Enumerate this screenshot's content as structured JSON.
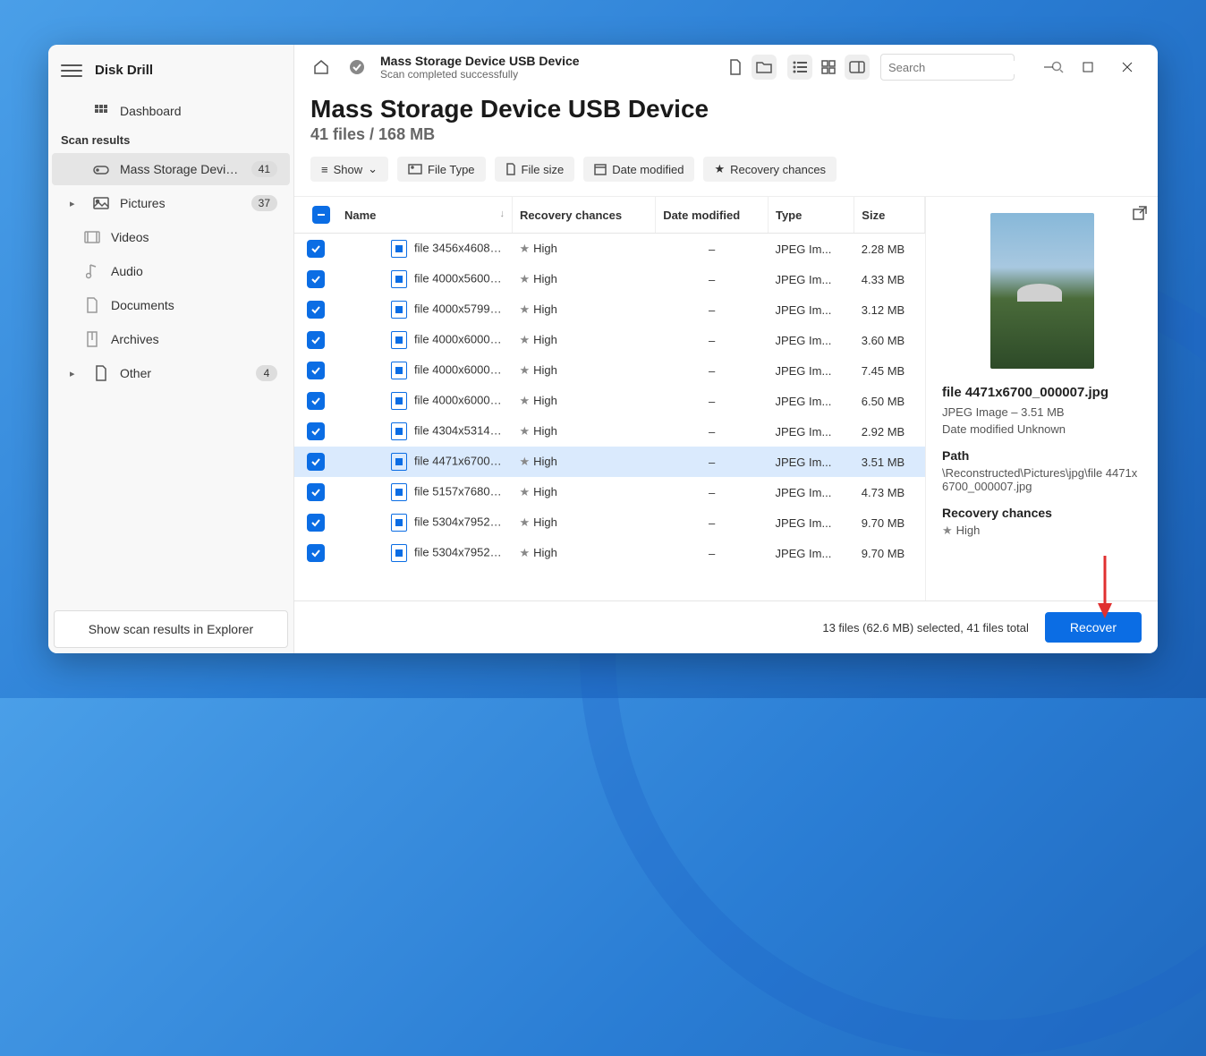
{
  "app": {
    "title": "Disk Drill"
  },
  "sidebar": {
    "dashboard": "Dashboard",
    "scan_results_label": "Scan results",
    "items": [
      {
        "label": "Mass Storage Device USB...",
        "badge": "41",
        "icon": "drive"
      },
      {
        "label": "Pictures",
        "badge": "37",
        "icon": "image",
        "expandable": true
      },
      {
        "label": "Videos",
        "icon": "video"
      },
      {
        "label": "Audio",
        "icon": "audio"
      },
      {
        "label": "Documents",
        "icon": "document"
      },
      {
        "label": "Archives",
        "icon": "archive"
      },
      {
        "label": "Other",
        "badge": "4",
        "icon": "other",
        "expandable": true
      }
    ],
    "explorer_button": "Show scan results in Explorer"
  },
  "header": {
    "breadcrumb_title": "Mass Storage Device USB Device",
    "breadcrumb_sub": "Scan completed successfully",
    "search_placeholder": "Search"
  },
  "page": {
    "title": "Mass Storage Device USB Device",
    "subtitle": "41 files / 168 MB"
  },
  "filters": {
    "show": "Show",
    "file_type": "File Type",
    "file_size": "File size",
    "date": "Date modified",
    "recovery": "Recovery chances"
  },
  "columns": {
    "name": "Name",
    "recovery": "Recovery chances",
    "date": "Date modified",
    "type": "Type",
    "size": "Size"
  },
  "rows": [
    {
      "name": "file 3456x4608_00...",
      "recovery": "High",
      "date": "–",
      "type": "JPEG Im...",
      "size": "2.28 MB"
    },
    {
      "name": "file 4000x5600_00...",
      "recovery": "High",
      "date": "–",
      "type": "JPEG Im...",
      "size": "4.33 MB"
    },
    {
      "name": "file 4000x5799_00...",
      "recovery": "High",
      "date": "–",
      "type": "JPEG Im...",
      "size": "3.12 MB"
    },
    {
      "name": "file 4000x6000_00...",
      "recovery": "High",
      "date": "–",
      "type": "JPEG Im...",
      "size": "3.60 MB"
    },
    {
      "name": "file 4000x6000_00...",
      "recovery": "High",
      "date": "–",
      "type": "JPEG Im...",
      "size": "7.45 MB"
    },
    {
      "name": "file 4000x6000_00...",
      "recovery": "High",
      "date": "–",
      "type": "JPEG Im...",
      "size": "6.50 MB"
    },
    {
      "name": "file 4304x5314_00...",
      "recovery": "High",
      "date": "–",
      "type": "JPEG Im...",
      "size": "2.92 MB"
    },
    {
      "name": "file 4471x6700_00...",
      "recovery": "High",
      "date": "–",
      "type": "JPEG Im...",
      "size": "3.51 MB",
      "selected": true
    },
    {
      "name": "file 5157x7680_00...",
      "recovery": "High",
      "date": "–",
      "type": "JPEG Im...",
      "size": "4.73 MB"
    },
    {
      "name": "file 5304x7952_00...",
      "recovery": "High",
      "date": "–",
      "type": "JPEG Im...",
      "size": "9.70 MB"
    },
    {
      "name": "file 5304x7952_00...",
      "recovery": "High",
      "date": "–",
      "type": "JPEG Im...",
      "size": "9.70 MB"
    }
  ],
  "preview": {
    "name": "file 4471x6700_000007.jpg",
    "meta1": "JPEG Image – 3.51 MB",
    "meta2": "Date modified Unknown",
    "path_label": "Path",
    "path": "\\Reconstructed\\Pictures\\jpg\\file 4471x6700_000007.jpg",
    "recovery_label": "Recovery chances",
    "recovery_value": "High"
  },
  "footer": {
    "status": "13 files (62.6 MB) selected, 41 files total",
    "recover": "Recover"
  }
}
